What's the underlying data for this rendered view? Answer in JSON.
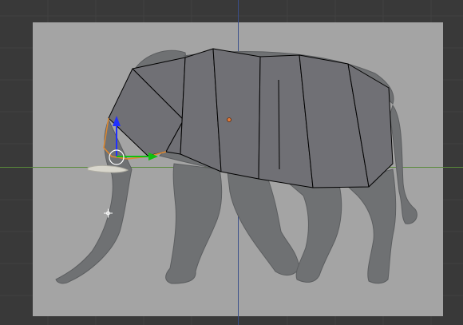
{
  "viewport": {
    "background_color": "#393939",
    "reference_image_color": "#a4a4a4",
    "x_axis_color": "#5a8a3a",
    "y_axis_color": "#3b4f8a"
  },
  "reference_image": {
    "subject": "elephant",
    "skin_color": "#6f7173"
  },
  "mesh": {
    "face_color": "#707075",
    "edge_color": "#000000",
    "selected_edge_color": "#e08a30",
    "origin_color": "#e07a3a"
  },
  "gizmo": {
    "z_axis_color": "#2030ff",
    "y_axis_color": "#10c010",
    "pivot_circle_color": "#ffffff"
  },
  "icons": [
    "3d-cursor-icon",
    "manipulator-circle-icon"
  ]
}
